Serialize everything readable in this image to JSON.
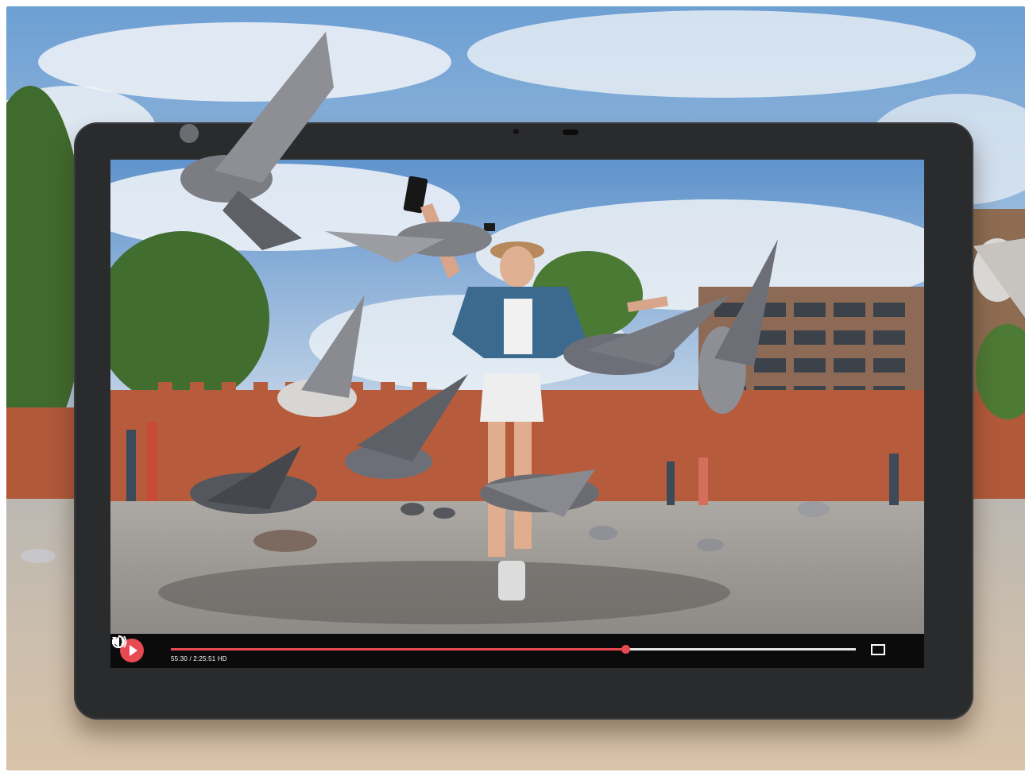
{
  "player": {
    "time_label": "55:30 / 2:25:51",
    "quality_label": "HD",
    "progress_fraction": 0.663,
    "accent_color": "#e84a54",
    "icons": {
      "play": "play-icon",
      "replay": "replay-icon",
      "fullscreen": "fullscreen-icon",
      "volume": "volume-icon"
    }
  }
}
